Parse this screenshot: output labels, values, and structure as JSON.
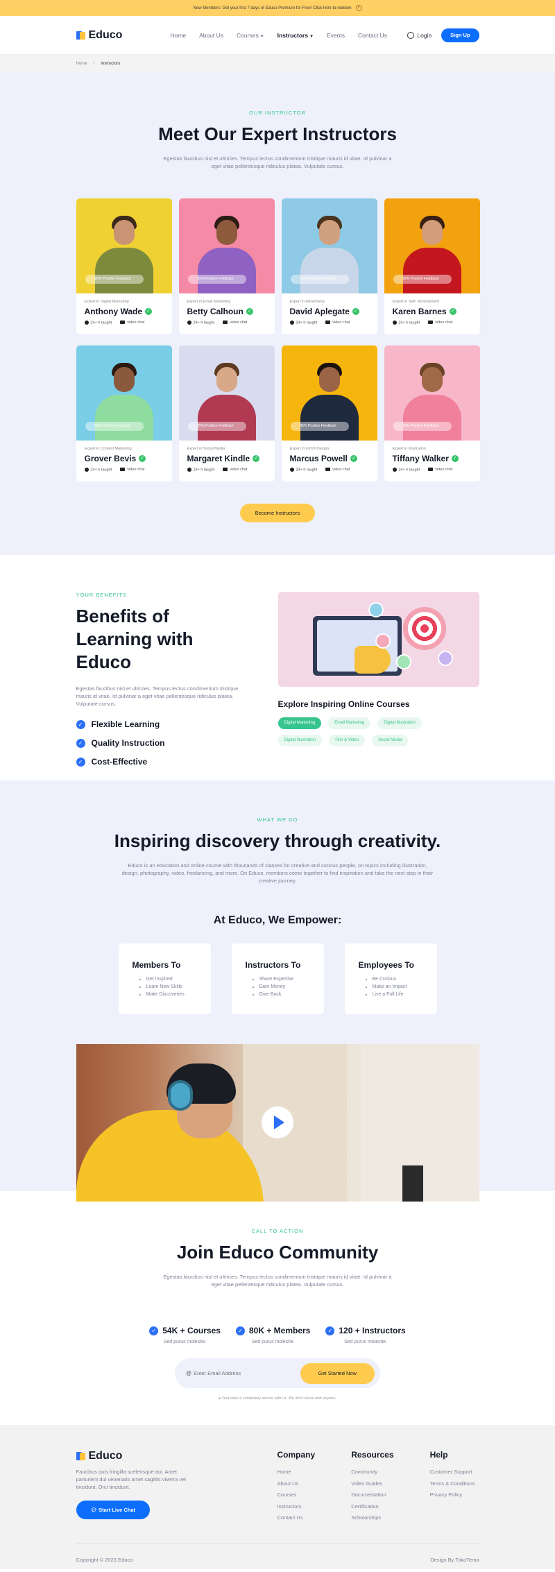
{
  "topbar": {
    "text": "New Members: Get your first 7 days of Educo Premium for Free! Click here to redeem",
    "close": "×"
  },
  "brand": {
    "name": "Educo",
    "colors": {
      "primary": "#0d6efd",
      "accent": "#ffcb4f",
      "green": "#36c58e"
    }
  },
  "nav": {
    "items": [
      {
        "label": "Home"
      },
      {
        "label": "About Us"
      },
      {
        "label": "Courses"
      },
      {
        "label": "Instructors"
      },
      {
        "label": "Events"
      },
      {
        "label": "Contact Us"
      }
    ],
    "login": "Login",
    "signup": "Sign Up"
  },
  "breadcrumb": {
    "home": "Home",
    "sep": "/",
    "current": "Instructors"
  },
  "instructors": {
    "eyebrow": "OUR INSTRUCTOR",
    "title": "Meet Our Expert Instructors",
    "lead": "Egestas faucibus nisl et ultricies. Tempus lectus condimentum tristique mauris id vitae. Id pulvinar a eget vitae pellentesque ridiculus platea. Vulputate cursus.",
    "list": [
      {
        "expertise": "Expert in Digital Marketing",
        "name": "Anthony Wade",
        "tag": "95% Positive Feedback",
        "taught": "24+ h taught",
        "video": "video chat"
      },
      {
        "expertise": "Expert in Email Marketing",
        "name": "Betty Calhoun",
        "tag": "95% Positive Feedback",
        "taught": "24+ h taught",
        "video": "video chat"
      },
      {
        "expertise": "Expert in Advertising",
        "name": "David Aplegate",
        "tag": "95% Positive Feedback",
        "taught": "24+ h taught",
        "video": "video chat"
      },
      {
        "expertise": "Expert in Self- development",
        "name": "Karen Barnes",
        "tag": "95% Positive Feedback",
        "taught": "24+ h taught",
        "video": "video chat"
      },
      {
        "expertise": "Expert in Content Marketing",
        "name": "Grover Bevis",
        "tag": "95% Positive Feedback",
        "taught": "24+ h taught",
        "video": "video chat"
      },
      {
        "expertise": "Expert in Social Media",
        "name": "Margaret Kindle",
        "tag": "95% Positive Feedback",
        "taught": "24+ h taught",
        "video": "video chat"
      },
      {
        "expertise": "Expert in UI/UX Design",
        "name": "Marcus Powell",
        "tag": "95% Positive Feedback",
        "taught": "24+ h taught",
        "video": "video chat"
      },
      {
        "expertise": "Expert in Illustration",
        "name": "Tiffany Walker",
        "tag": "95% Positive Feedback",
        "taught": "24+ h taught",
        "video": "video chat"
      }
    ],
    "cta": "Become Instructors"
  },
  "benefits": {
    "eyebrow": "YOUR BENEFITS",
    "title": "Benefits of Learning with Educo",
    "lead": "Egestas faucibus nisl et ultricies. Tempus lectus condimentum tristique mauris id vitae. Id pulvinar a eget vitae pellentesque ridiculus platea. Vulputate cursus.",
    "items": [
      "Flexible Learning",
      "Quality Instruction",
      "Cost-Effective"
    ],
    "courses_title": "Explore Inspiring Online Courses",
    "chips": [
      "Digital Marketing",
      "Email Marketing",
      "Digital Illustration",
      "Digital Illustration",
      "Film & Video",
      "Social Media"
    ]
  },
  "whatwedo": {
    "eyebrow": "WHAT WE DO",
    "title": "Inspiring discovery through creativity.",
    "lead": "Educo is an education and online course with thousands of classes for creative and curious people, on topics including illustration, design, photography, video, freelancing, and more. On Educo, members come together to find inspiration and take the next step in their creative journey.",
    "empower": "At Educo, We Empower:",
    "boxes": [
      {
        "title": "Members To",
        "items": [
          "Get Inspired",
          "Learn New Skills",
          "Make Discoveries"
        ]
      },
      {
        "title": "Instructors To",
        "items": [
          "Share Expertise",
          "Earn Money",
          "Give Back"
        ]
      },
      {
        "title": "Employees To",
        "items": [
          "Be Curious",
          "Make an Impact",
          "Live a Full Life"
        ]
      }
    ]
  },
  "cta": {
    "eyebrow": "CALL TO ACTION",
    "title": "Join Educo Community",
    "lead": "Egestas faucibus nisl et ultricies. Tempus lectus condimentum tristique mauris id vitae. Id pulvinar a eget vitae pellentesque ridiculus platea. Vulputate cursus.",
    "stats": [
      {
        "title": "54K + Courses",
        "sub": "Sed purus molestie."
      },
      {
        "title": "80K + Members",
        "sub": "Sed purus molestie."
      },
      {
        "title": "120 + Instructors",
        "sub": "Sed purus molestie."
      }
    ],
    "email_placeholder": "Enter Email Address",
    "button": "Get Started Now",
    "note": "Your data is completely secure with us. We don't share with anyone."
  },
  "footer": {
    "desc": "Faucibus quis fringilla scelerisque dui. Amet parturient dui venenatis amet sagittis viverra vel tincidunt. Orci tincidunt.",
    "chat": "Start Live Chat",
    "cols": [
      {
        "title": "Company",
        "items": [
          "Home",
          "About Us",
          "Courses",
          "Instructors",
          "Contact Us"
        ]
      },
      {
        "title": "Resources",
        "items": [
          "Community",
          "Video Guides",
          "Documentation",
          "Certification",
          "Scholarships"
        ]
      },
      {
        "title": "Help",
        "items": [
          "Customer Support",
          "Terms & Conditions",
          "Privacy Policy"
        ]
      }
    ],
    "copyright": "Copyright © 2023 Educo",
    "credit": "Design By TokoTema"
  }
}
